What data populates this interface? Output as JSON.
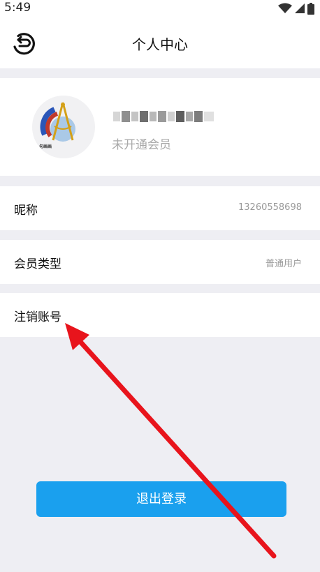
{
  "status_bar": {
    "time": "5:49",
    "icons": [
      "wifi-icon",
      "signal-icon",
      "battery-icon"
    ]
  },
  "header": {
    "title": "个人中心",
    "back_icon": "back-icon"
  },
  "profile": {
    "avatar_text": "句画画",
    "username": "",
    "membership_status": "未开通会员"
  },
  "rows": [
    {
      "label": "昵称",
      "value": "13260558698"
    },
    {
      "label": "会员类型",
      "value": "普通用户"
    },
    {
      "label": "注销账号",
      "value": ""
    }
  ],
  "logout_label": "退出登录",
  "colors": {
    "accent": "#1aa0ee",
    "annotation_arrow": "#e8141c",
    "background": "#eeeef3"
  }
}
